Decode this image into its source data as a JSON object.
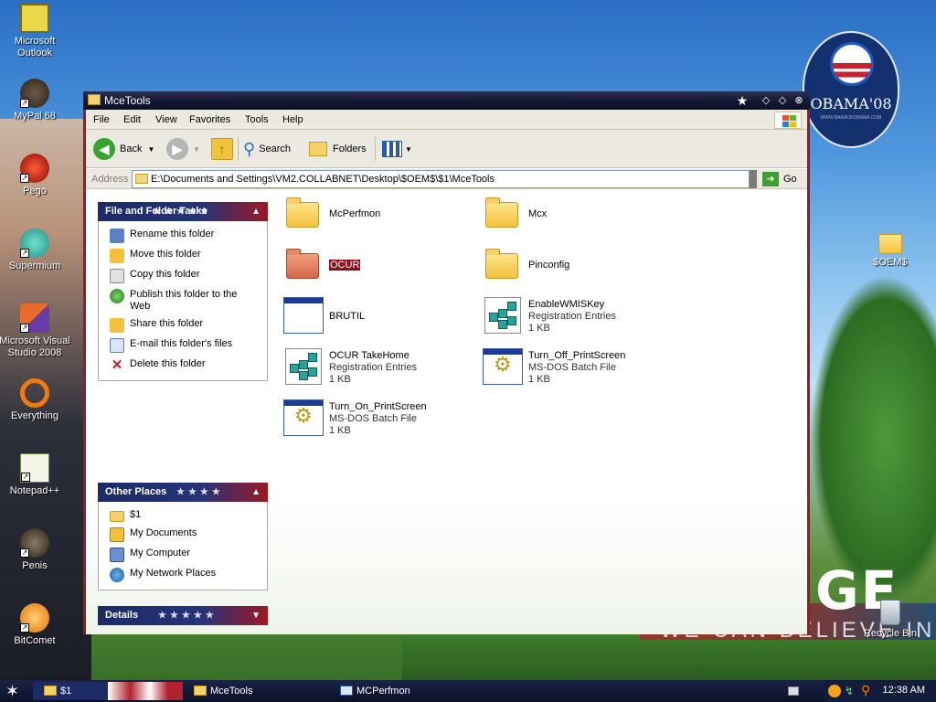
{
  "desktop": {
    "icons": [
      {
        "label": "Microsoft\nOutlook",
        "name": "outlook"
      },
      {
        "label": "MyPal 68",
        "name": "mypal"
      },
      {
        "label": "Pego",
        "name": "pego"
      },
      {
        "label": "Supermium",
        "name": "supermium"
      },
      {
        "label": "Microsoft Visual\nStudio 2008",
        "name": "visual-studio"
      },
      {
        "label": "Everything",
        "name": "everything"
      },
      {
        "label": "Notepad++",
        "name": "notepad-plus-plus"
      },
      {
        "label": "Penis",
        "name": "penis"
      },
      {
        "label": "BitComet",
        "name": "bitcomet"
      }
    ],
    "right_icons": [
      {
        "label": "$OEM$"
      },
      {
        "label": "Recycle Bin"
      }
    ],
    "logo_text": "OBAMA'08",
    "logo_sub": "WWW.BARACKOBAMA.COM",
    "wallpaper_big": "GE",
    "wallpaper_small": "WE CAN BELIEVE IN"
  },
  "window": {
    "title": "MceTools",
    "menu": [
      "File",
      "Edit",
      "View",
      "Favorites",
      "Tools",
      "Help"
    ],
    "toolbar": {
      "back": "Back",
      "search": "Search",
      "folders": "Folders"
    },
    "address": {
      "label": "Address",
      "path": "E:\\Documents and Settings\\VM2.COLLABNET\\Desktop\\$OEM$\\$1\\MceTools",
      "go": "Go"
    },
    "panels": {
      "file_folder_tasks": {
        "title": "File and Folder Tasks",
        "items": [
          "Rename this folder",
          "Move this folder",
          "Copy this folder",
          "Publish this folder to the Web",
          "Share this folder",
          "E-mail this folder's files",
          "Delete this folder"
        ]
      },
      "other_places": {
        "title": "Other Places",
        "items": [
          "$1",
          "My Documents",
          "My Computer",
          "My Network Places"
        ]
      },
      "details": {
        "title": "Details"
      }
    },
    "files": [
      {
        "name": "McPerfmon",
        "type": "",
        "size": ""
      },
      {
        "name": "Mcx",
        "type": "",
        "size": ""
      },
      {
        "name": "OCUR",
        "type": "",
        "size": ""
      },
      {
        "name": "Pinconfig",
        "type": "",
        "size": ""
      },
      {
        "name": "BRUTIL",
        "type": "",
        "size": ""
      },
      {
        "name": "EnableWMISKey",
        "type": "Registration Entries",
        "size": "1 KB"
      },
      {
        "name": "OCUR TakeHome",
        "type": "Registration Entries",
        "size": "1 KB"
      },
      {
        "name": "Turn_Off_PrintScreen",
        "type": "MS-DOS Batch File",
        "size": "1 KB"
      },
      {
        "name": "Turn_On_PrintScreen",
        "type": "MS-DOS Batch File",
        "size": "1 KB"
      }
    ]
  },
  "taskbar": {
    "tasks": [
      {
        "label": "$1"
      },
      {
        "label": "MceTools"
      },
      {
        "label": "MCPerfmon"
      }
    ],
    "clock": "12:38 AM"
  },
  "colors": {
    "accent_red": "#9a1a22",
    "title_navy": "#131833",
    "selection": "#8b0f1d"
  }
}
